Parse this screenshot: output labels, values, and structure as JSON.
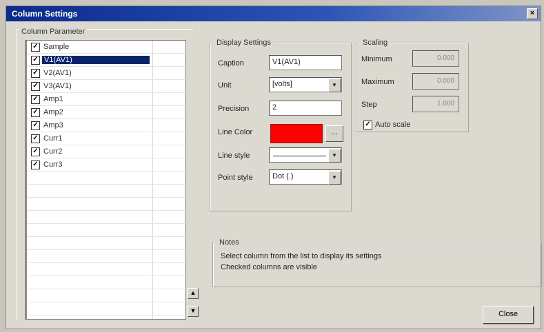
{
  "window": {
    "title": "Column Settings",
    "close_glyph": "×"
  },
  "columns": {
    "group_label": "Column Parameter",
    "items": [
      {
        "label": "Sample",
        "checked": true,
        "selected": false
      },
      {
        "label": "V1(AV1)",
        "checked": true,
        "selected": true
      },
      {
        "label": "V2(AV1)",
        "checked": true,
        "selected": false
      },
      {
        "label": "V3(AV1)",
        "checked": true,
        "selected": false
      },
      {
        "label": "Amp1",
        "checked": true,
        "selected": false
      },
      {
        "label": "Amp2",
        "checked": true,
        "selected": false
      },
      {
        "label": "Amp3",
        "checked": true,
        "selected": false
      },
      {
        "label": "Curr1",
        "checked": true,
        "selected": false
      },
      {
        "label": "Curr2",
        "checked": true,
        "selected": false
      },
      {
        "label": "Curr3",
        "checked": true,
        "selected": false
      }
    ],
    "empty_rows": 11,
    "scroll_up_glyph": "▲",
    "scroll_down_glyph": "▼"
  },
  "display": {
    "group_label": "Display Settings",
    "caption_label": "Caption",
    "caption_value": "V1(AV1)",
    "unit_label": "Unit",
    "unit_value": "[volts]",
    "precision_label": "Precision",
    "precision_value": "2",
    "line_color_label": "Line Color",
    "line_color": "#ff0000",
    "dots_label": "...",
    "line_style_label": "Line style",
    "point_style_label": "Point style",
    "point_style_value": "Dot (.)",
    "combo_glyph": "▼"
  },
  "scaling": {
    "group_label": "Scaling",
    "minimum_label": "Minimum",
    "minimum_value": "0.000",
    "maximum_label": "Maximum",
    "maximum_value": "0.000",
    "step_label": "Step",
    "step_value": "1.000",
    "autoscale_label": "Auto scale",
    "autoscale_checked": true
  },
  "notes": {
    "group_label": "Notes",
    "line1": "Select column from the list to display its settings",
    "line2": "Checked columns are visible"
  },
  "footer": {
    "close_label": "Close"
  }
}
